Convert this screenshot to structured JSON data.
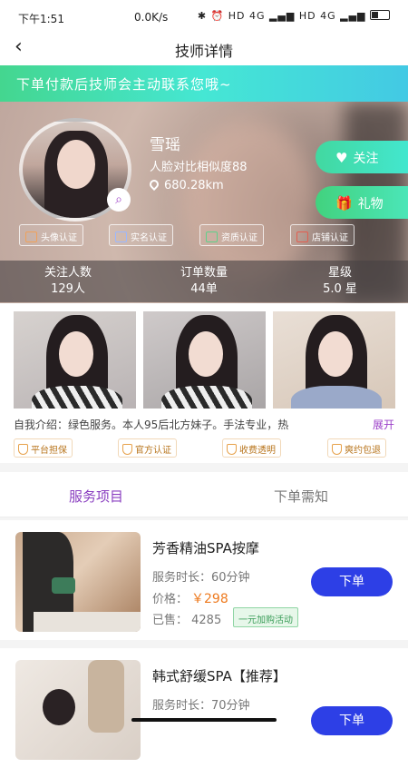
{
  "status": {
    "time": "下午1:51",
    "network": "0.0K/s",
    "icons": "✱ ⏰ HD 4G ▂▄▆ HD 4G ▂▄▆"
  },
  "nav": {
    "back": "‹",
    "title": "技师详情"
  },
  "banner": "下单付款后技师会主动联系您哦~",
  "profile": {
    "name": "雪瑶",
    "similarity": "人脸对比相似度88",
    "distance": "680.28km",
    "follow_label": "关注",
    "gift_label": "礼物",
    "badges": [
      "头像认证",
      "实名认证",
      "资质认证",
      "店铺认证"
    ]
  },
  "stats": [
    {
      "label": "关注人数",
      "value": "129人"
    },
    {
      "label": "订单数量",
      "value": "44单"
    },
    {
      "label": "星级",
      "value": "5.0 星"
    }
  ],
  "intro": {
    "text": "自我介绍：绿色服务。本人95后北方妹子。手法专业，热",
    "more": "展开"
  },
  "guarantees": [
    "平台担保",
    "官方认证",
    "收费透明",
    "爽约包退"
  ],
  "tabs": [
    "服务项目",
    "下单需知"
  ],
  "services": [
    {
      "name": "芳香精油SPA按摩",
      "duration": "服务时长：60分钟",
      "price_label": "价格：",
      "price": "￥298",
      "sold": "已售：  4285",
      "promo": "一元加购活动",
      "order": "下单"
    },
    {
      "name": "韩式舒缓SPA【推荐】",
      "duration": "服务时长：70分钟",
      "order": "下单"
    }
  ],
  "colors": {
    "accent": "#8a3fc0",
    "button": "#2d3fe6",
    "price": "#ee7a1e",
    "banner": "#44d68f"
  }
}
